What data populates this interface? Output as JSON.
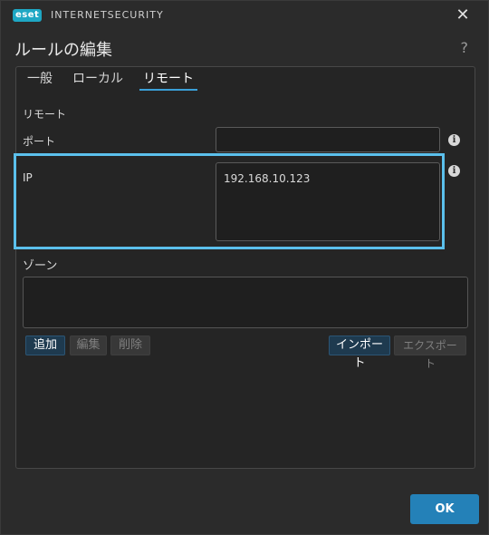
{
  "titlebar": {
    "logo_text": "eset",
    "product_name": "INTERNETSECURITY",
    "close_symbol": "✕"
  },
  "dialog": {
    "title": "ルールの編集",
    "help_symbol": "?"
  },
  "tabs": [
    {
      "label": "一般",
      "active": false
    },
    {
      "label": "ローカル",
      "active": false
    },
    {
      "label": "リモート",
      "active": true
    }
  ],
  "remote": {
    "section_label": "リモート",
    "port": {
      "label": "ポート",
      "value": ""
    },
    "ip": {
      "label": "IP",
      "value": "192.168.10.123"
    },
    "zone": {
      "label": "ゾーン"
    }
  },
  "zone_buttons": {
    "add": "追加",
    "edit": "編集",
    "delete": "削除",
    "import": "インポート",
    "export": "エクスポート"
  },
  "footer": {
    "ok_label": "OK"
  },
  "colors": {
    "accent": "#2481b8",
    "highlight": "#5bc0ec",
    "brand": "#1ea7c4"
  },
  "icons": {
    "info": "info-icon",
    "close": "close-icon"
  }
}
